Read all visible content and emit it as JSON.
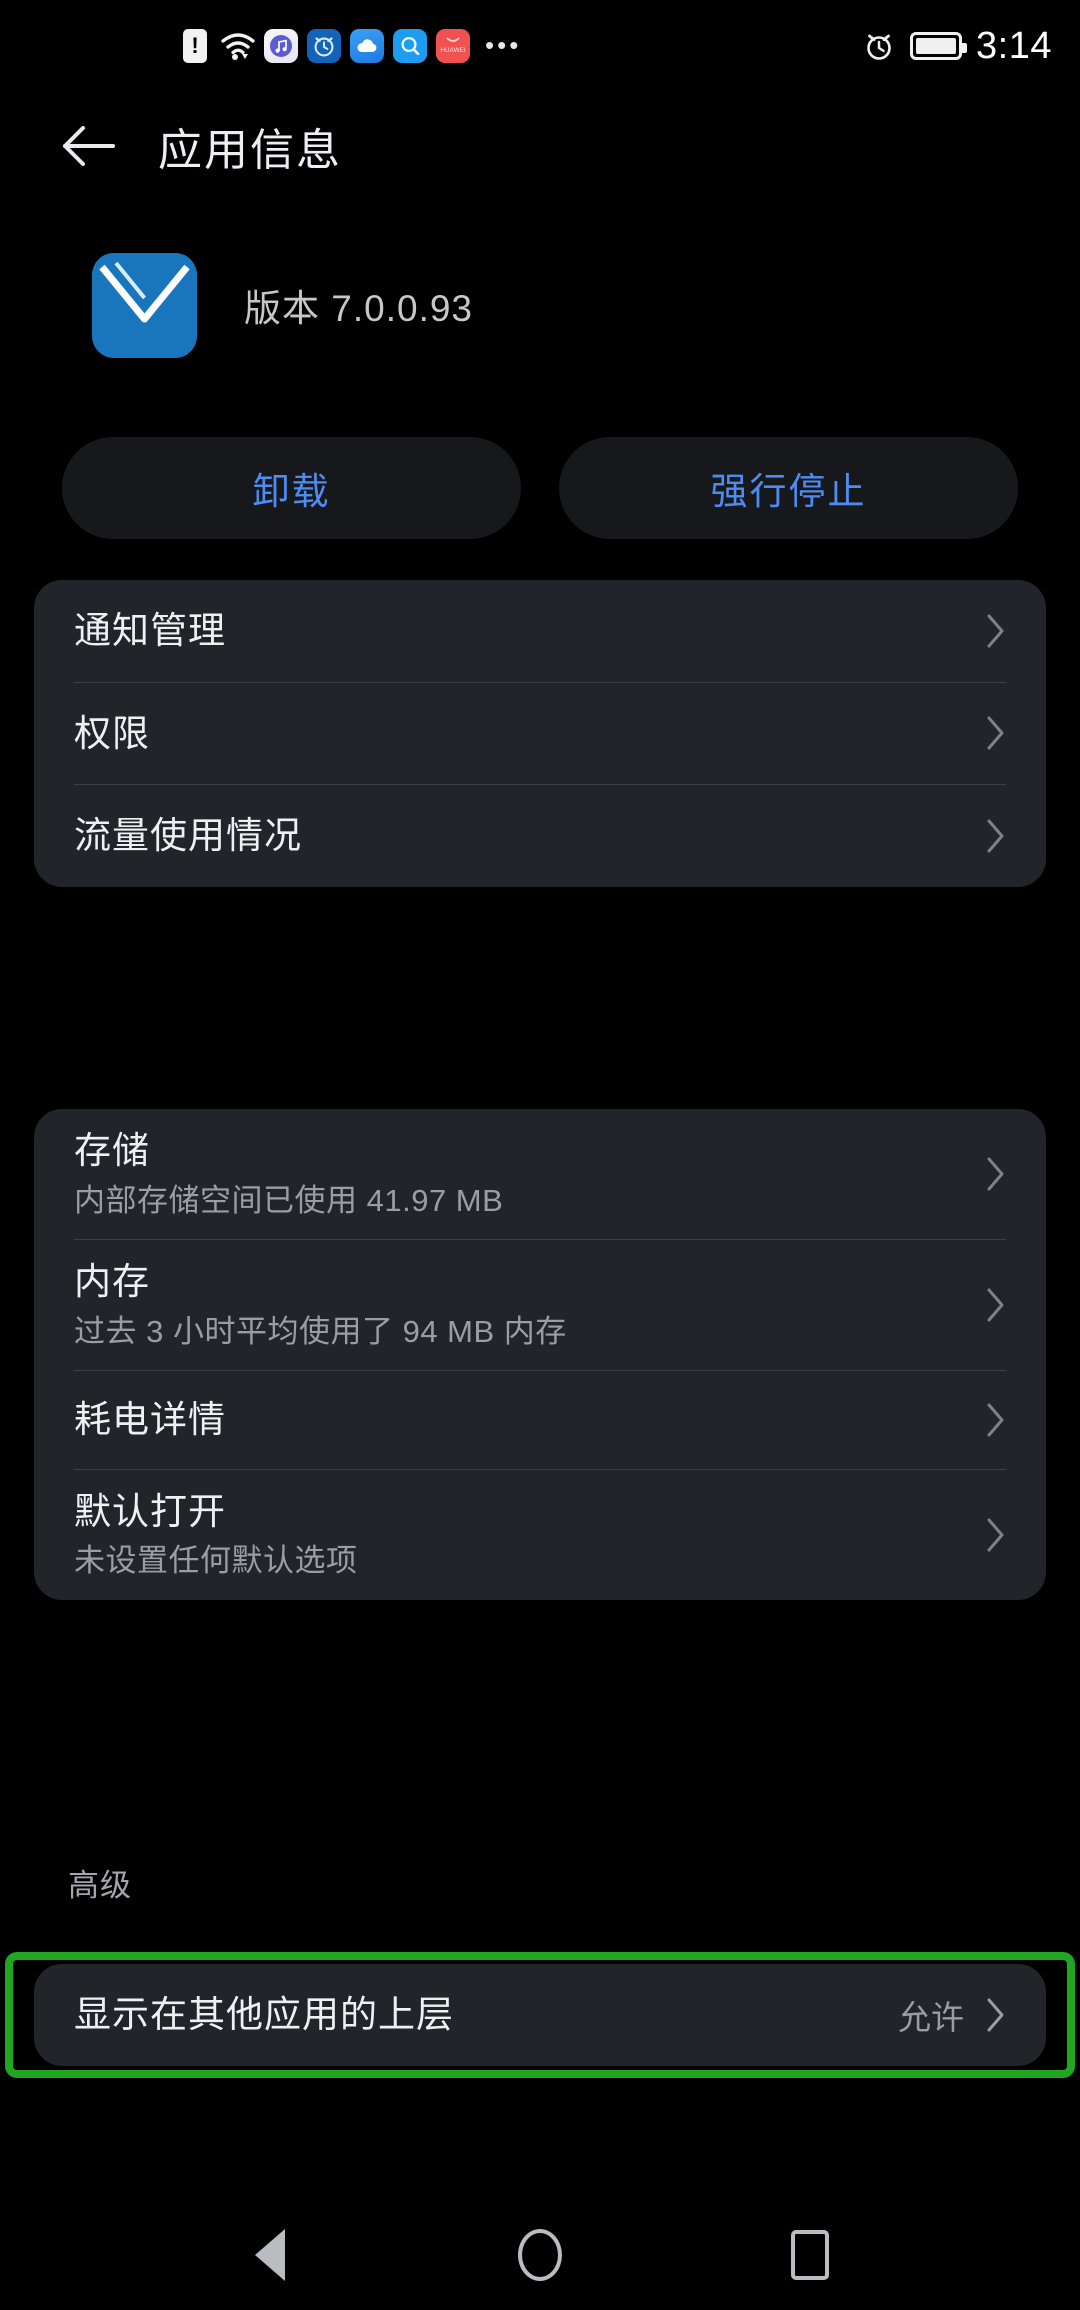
{
  "statusbar": {
    "icons": [
      {
        "name": "sim-card-alert-icon",
        "label": "!"
      },
      {
        "name": "wifi-icon",
        "label": "wifi"
      },
      {
        "name": "music-app-icon",
        "label": "♫"
      },
      {
        "name": "alarm-app-icon",
        "label": "alarm"
      },
      {
        "name": "cloud-app-icon",
        "label": "cloud"
      },
      {
        "name": "search-app-icon",
        "label": "search"
      },
      {
        "name": "huawei-app-icon",
        "label": "HUAWEI"
      },
      {
        "name": "overflow-dots-icon",
        "label": "•••"
      }
    ],
    "alarm_icon": "alarm-clock-icon",
    "battery_icon": "battery-full-icon",
    "time": "3:14"
  },
  "header": {
    "back_icon": "back-arrow-icon",
    "title": "应用信息"
  },
  "app": {
    "icon": "email-app-icon",
    "version": "版本 7.0.0.93"
  },
  "actions": {
    "uninstall_label": "卸载",
    "force_stop_label": "强行停止",
    "accent_color": "#4d8df2"
  },
  "cards": {
    "general": [
      {
        "title": "通知管理",
        "sub": "",
        "value": ""
      },
      {
        "title": "权限",
        "sub": "",
        "value": ""
      },
      {
        "title": "流量使用情况",
        "sub": "",
        "value": ""
      }
    ],
    "usage": [
      {
        "title": "存储",
        "sub": "内部存储空间已使用 41.97 MB",
        "value": ""
      },
      {
        "title": "内存",
        "sub": "过去 3 小时平均使用了 94 MB 内存",
        "value": ""
      },
      {
        "title": "耗电详情",
        "sub": "",
        "value": ""
      },
      {
        "title": "默认打开",
        "sub": "未设置任何默认选项",
        "value": ""
      }
    ],
    "advanced_label": "高级",
    "advanced": [
      {
        "title": "显示在其他应用的上层",
        "sub": "",
        "value": "允许"
      }
    ]
  },
  "highlight": {
    "color": "#21a621"
  },
  "navbar": {
    "back": "nav-back-icon",
    "home": "nav-home-icon",
    "recents": "nav-recents-icon"
  }
}
